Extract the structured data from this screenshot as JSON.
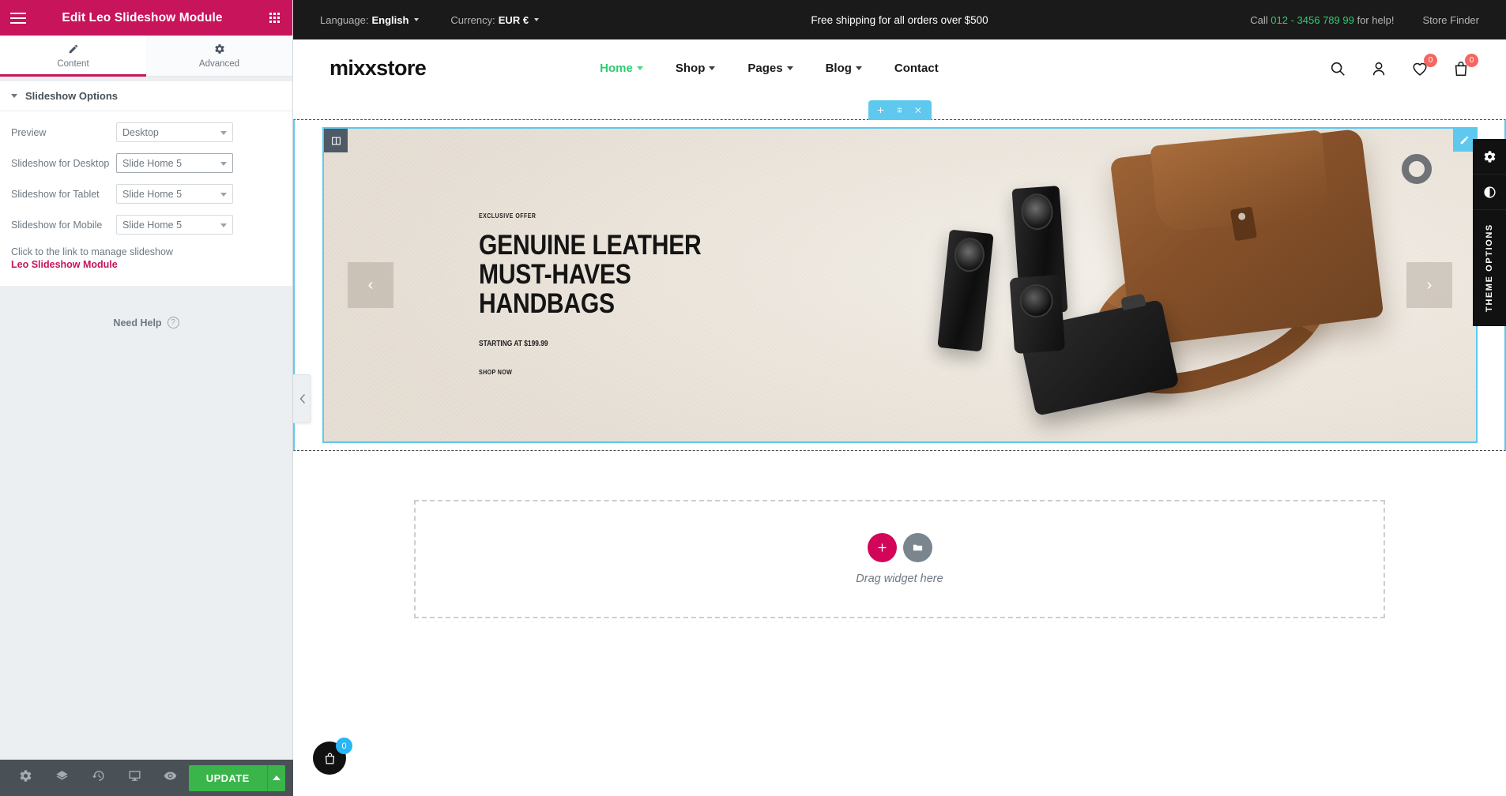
{
  "editor": {
    "header": {
      "title": "Edit Leo Slideshow Module",
      "menu_icon": "hamburger-icon",
      "grid_icon": "apps-grid-icon"
    },
    "tabs": [
      {
        "label": "Content",
        "icon": "pencil-icon",
        "active": true
      },
      {
        "label": "Advanced",
        "icon": "gear-icon",
        "active": false
      }
    ],
    "section": {
      "title": "Slideshow Options",
      "collapse_icon": "caret-down-icon"
    },
    "fields": [
      {
        "label": "Preview",
        "value": "Desktop",
        "focused": false
      },
      {
        "label": "Slideshow for Desktop",
        "value": "Slide Home 5",
        "focused": true
      },
      {
        "label": "Slideshow for Tablet",
        "value": "Slide Home 5",
        "focused": false
      },
      {
        "label": "Slideshow for Mobile",
        "value": "Slide Home 5",
        "focused": false
      }
    ],
    "hint": "Click to the link to manage slideshow",
    "hint_link": "Leo Slideshow Module",
    "need_help": "Need Help",
    "footer": {
      "icons": [
        "settings-gear-icon",
        "layers-icon",
        "history-icon",
        "responsive-monitor-icon",
        "preview-eye-icon"
      ],
      "update_label": "UPDATE",
      "update_arrow_icon": "caret-up-icon"
    },
    "collapse_handle_icon": "chevron-left-icon",
    "accent_color": "#c7145a",
    "update_color": "#39b54a"
  },
  "site": {
    "topbar": {
      "language_label": "Language:",
      "language_value": "English",
      "currency_label": "Currency:",
      "currency_value": "EUR €",
      "promo": "Free shipping for all orders over $500",
      "call_prefix": "Call",
      "phone": "012 - 3456 789 99",
      "call_suffix": "for help!",
      "store_finder": "Store Finder",
      "phone_color": "#2ecc71"
    },
    "header": {
      "logo": "mixxstore",
      "nav": [
        {
          "label": "Home",
          "has_caret": true,
          "active": true
        },
        {
          "label": "Shop",
          "has_caret": true,
          "active": false
        },
        {
          "label": "Pages",
          "has_caret": true,
          "active": false
        },
        {
          "label": "Blog",
          "has_caret": true,
          "active": false
        },
        {
          "label": "Contact",
          "has_caret": false,
          "active": false
        }
      ],
      "icons": [
        {
          "name": "search-icon",
          "badge": null
        },
        {
          "name": "user-account-icon",
          "badge": null
        },
        {
          "name": "wishlist-heart-icon",
          "badge": "0"
        },
        {
          "name": "shopping-bag-icon",
          "badge": "0"
        }
      ],
      "active_color": "#2ecc71",
      "badge_color": "#f4665f"
    },
    "slide": {
      "eyebrow": "EXCLUSIVE OFFER",
      "title_line1": "GENUINE LEATHER",
      "title_line2": "MUST-HAVES",
      "title_line3": "HANDBAGS",
      "price": "STARTING AT $199.99",
      "cta": "SHOP NOW",
      "prev_icon": "chevron-left-icon",
      "next_icon": "chevron-right-icon",
      "background_color": "#ece6dd"
    },
    "builder": {
      "section_toolbar": [
        "plus-icon",
        "drag-dots-icon",
        "close-x-icon"
      ],
      "column_handle_icon": "column-icon",
      "edit_handle_icon": "pencil-edit-icon",
      "selection_color": "#5ec8ee"
    },
    "drop_zone": {
      "add_icon": "plus-icon",
      "folder_icon": "folder-icon",
      "text": "Drag widget here",
      "add_color": "#d3055a",
      "folder_color": "#7b858e"
    },
    "theme_rail": {
      "buttons": [
        "gear-icon",
        "contrast-icon"
      ],
      "label": "THEME OPTIONS"
    },
    "float_cart": {
      "icon": "shopping-bag-icon",
      "badge": "0",
      "badge_color": "#29b6f6"
    }
  }
}
